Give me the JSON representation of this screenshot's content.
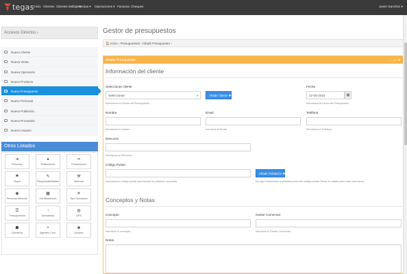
{
  "nav": {
    "logo_text": "tegas",
    "items": [
      "Inicio",
      "Clientes",
      "Clientes Múltiples",
      "Ventas ▾",
      "Operaciones ▾",
      "Facturas",
      "Cheques"
    ],
    "user": "Javier Sanchez ▾"
  },
  "sidebar": {
    "accesos_title": "Accesos Directos ›",
    "menu": [
      {
        "label": "Nuevo Cliente",
        "icon": "user-plus-icon"
      },
      {
        "label": "Nueva Venta",
        "icon": "cart-icon"
      },
      {
        "label": "Nueva Operación",
        "icon": "exchange-icon"
      },
      {
        "label": "Nuevo Producto",
        "icon": "box-icon"
      },
      {
        "label": "Nuevo Presupuesto",
        "icon": "list-icon",
        "active": true
      },
      {
        "label": "Nuevo Personal",
        "icon": "person-icon"
      },
      {
        "label": "Nueva Población",
        "icon": "map-marker-icon"
      },
      {
        "label": "Nuevo Proveedor",
        "icon": "truck-icon"
      },
      {
        "label": "Nuevo Usuario",
        "icon": "user-icon"
      }
    ],
    "otros_title": "Otros Listados",
    "tiles": [
      {
        "label": "Personas",
        "glyph": "➜",
        "icon": "arrow-right-icon"
      },
      {
        "label": "Poblaciones",
        "glyph": "●",
        "icon": "map-marker-icon"
      },
      {
        "label": "Proveedores",
        "glyph": "━",
        "icon": "minus-icon"
      },
      {
        "label": "Ropa",
        "glyph": "⚑",
        "icon": "tag-icon"
      },
      {
        "label": "Responsabilidades",
        "glyph": "✎",
        "icon": "edit-icon"
      },
      {
        "label": "Vehículo",
        "glyph": "⚒",
        "icon": "wrench-icon"
      },
      {
        "label": "Personal Vehículo",
        "glyph": "◉",
        "icon": "steering-icon"
      },
      {
        "label": "Certificaciones",
        "glyph": "▦",
        "icon": "certificate-icon"
      },
      {
        "label": "Tipo Operación",
        "glyph": "✈",
        "icon": "plane-icon"
      },
      {
        "label": "Presupuestos",
        "glyph": "☰",
        "icon": "list-icon"
      },
      {
        "label": "Demandas",
        "glyph": "↑",
        "icon": "arrow-up-icon"
      },
      {
        "label": "UPS",
        "glyph": "◍",
        "icon": "globe-icon"
      },
      {
        "label": "Operarios",
        "glyph": "☗",
        "icon": "group-icon"
      },
      {
        "label": "Agentes Com.",
        "glyph": "+",
        "icon": "plus-icon"
      },
      {
        "label": "Usuario",
        "glyph": "☻",
        "icon": "user-icon"
      }
    ]
  },
  "main": {
    "title": "Gestor de presupuestos",
    "breadcrumb": "🏠 Inicio  ›  Presupuestos  ›  Añadir Presupuesto  ›",
    "panel_title": "Añadir Presupuesto",
    "panel_tools": "⌄ ⤢ ⟳",
    "section1": "Información del cliente",
    "select_cliente_label": "Seleccionar cliente",
    "select_cliente_value": "Seleccionar",
    "select_cliente_help": "Seleccione el Cliente del Presupuesto.",
    "add_cliente_btn": "Añadir Cliente ✚",
    "fecha_label": "Fecha",
    "fecha_value": "12-05-2015",
    "fecha_help": "Introduzca la Fecha del Presupuesto.",
    "nombre_label": "Nombre",
    "nombre_help": "Introduzca el nombre.",
    "email_label": "Email",
    "email_help": "Introducir el Email.",
    "telefono_label": "Teléfono",
    "telefono_help": "Introduzca el Teléfono.",
    "direccion_label": "Dirección",
    "direccion_help": "Introduzca la Dirección.",
    "cp_label": "Código Postal",
    "cp_help": "Introduzca el código postal para buscar la población asociada.",
    "add_poblacion_btn": "Añadir Población ✚",
    "poblacion_help": "No hay Poblaciones insertadas para este código postal. Pulse en añadir para crear una nueva.",
    "section2": "Conceptos y Notas",
    "concepto_label": "Concepto",
    "concepto_help": "Introducir el concepto.",
    "gestor_label": "Gestor Comercial",
    "gestor_help": "Introducir el Gestor Comercial.",
    "notas_label": "Notas"
  },
  "colors": {
    "topbar": "#3a3a3a",
    "active_blue": "#1a8fdd",
    "panel_orange": "#f9b44a",
    "button_blue": "#3a8ee6"
  }
}
